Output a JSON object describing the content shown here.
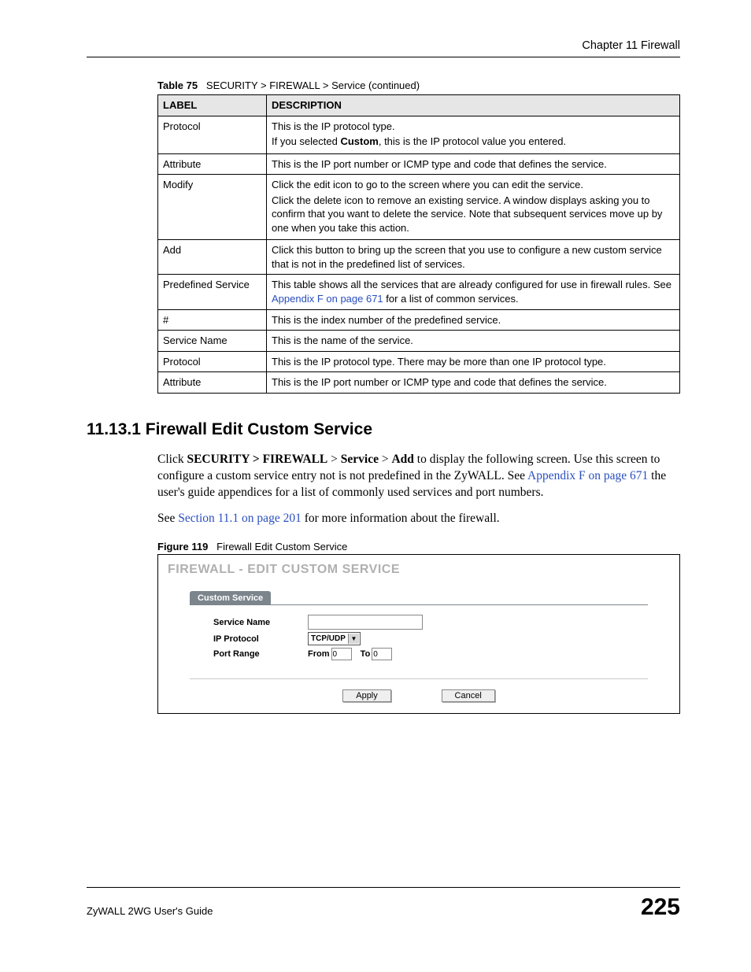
{
  "chapter_header": "Chapter 11 Firewall",
  "table_caption_bold": "Table 75",
  "table_caption_text": "SECURITY > FIREWALL > Service (continued)",
  "table": {
    "col1": "Label",
    "col2": "Description",
    "rows": [
      {
        "label": "Protocol",
        "desc": {
          "line1": "This is the IP protocol type.",
          "line2_pre": "If you selected ",
          "line2_bold": "Custom",
          "line2_post": ", this is the IP protocol value you entered."
        }
      },
      {
        "label": "Attribute",
        "plain": "This is the IP port number or ICMP type and code that defines the service."
      },
      {
        "label": "Modify",
        "desc": {
          "line1": "Click the edit icon to go to the screen where you can edit the service.",
          "line2": "Click the delete icon to remove an existing service. A window displays asking you to confirm that you want to delete the service. Note that subsequent services move up by one when you take this action."
        }
      },
      {
        "label": "Add",
        "plain": "Click this button to bring up the screen that you use to configure a new custom service that is not in the predefined list of services."
      },
      {
        "label": "Predefined Service",
        "desc": {
          "pre": "This table shows all the services that are already configured for use in firewall rules. See ",
          "link": "Appendix F on page 671",
          "post": " for a list of common services."
        }
      },
      {
        "label": "#",
        "plain": "This is the index number of the predefined service."
      },
      {
        "label": "Service Name",
        "plain": "This is the name of the service."
      },
      {
        "label": "Protocol",
        "plain": "This is the IP protocol type. There may be more than one IP protocol type."
      },
      {
        "label": "Attribute",
        "plain": "This is the IP port number or ICMP type and code that defines the service."
      }
    ]
  },
  "section_title": "11.13.1  Firewall Edit Custom Service",
  "para1": {
    "pre": "Click ",
    "crumb": "SECURITY > FIREWALL",
    "sep1": " > ",
    "b1": "Service",
    "sep2": " > ",
    "b2": "Add",
    "post": " to display the following screen. Use this screen to configure a custom service entry not is not predefined in the ZyWALL. See ",
    "link": "Appendix F on page 671",
    "tail": " the user's guide appendices for a list of commonly used services and port numbers."
  },
  "para2": {
    "pre": "See ",
    "link": "Section 11.1 on page 201",
    "post": " for more information about the firewall."
  },
  "figure_caption_bold": "Figure 119",
  "figure_caption_text": "Firewall Edit Custom Service",
  "panel": {
    "title": "FIREWALL - EDIT CUSTOM SERVICE",
    "tab": "Custom Service",
    "fields": {
      "service_name": "Service Name",
      "ip_protocol": "IP Protocol",
      "port_range": "Port Range",
      "from": "From",
      "to": "To",
      "protocol_value": "TCP/UDP",
      "from_value": "0",
      "to_value": "0"
    },
    "buttons": {
      "apply": "Apply",
      "cancel": "Cancel"
    }
  },
  "footer_guide": "ZyWALL 2WG User's Guide",
  "footer_page": "225"
}
